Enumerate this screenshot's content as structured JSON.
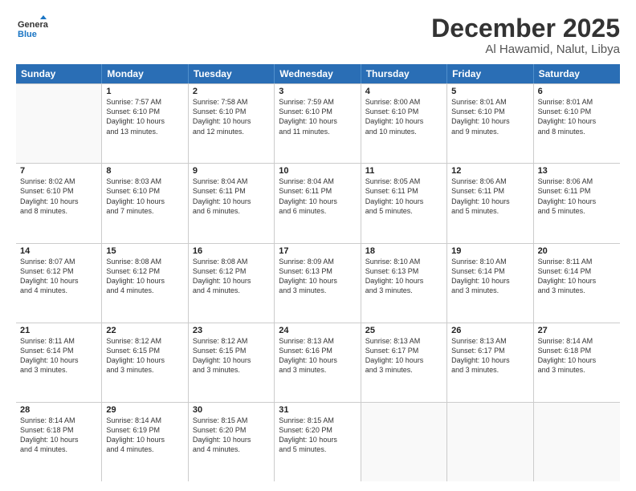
{
  "header": {
    "logo_line1": "General",
    "logo_line2": "Blue",
    "month": "December 2025",
    "location": "Al Hawamid, Nalut, Libya"
  },
  "weekdays": [
    "Sunday",
    "Monday",
    "Tuesday",
    "Wednesday",
    "Thursday",
    "Friday",
    "Saturday"
  ],
  "rows": [
    [
      {
        "day": "",
        "info": ""
      },
      {
        "day": "1",
        "info": "Sunrise: 7:57 AM\nSunset: 6:10 PM\nDaylight: 10 hours\nand 13 minutes."
      },
      {
        "day": "2",
        "info": "Sunrise: 7:58 AM\nSunset: 6:10 PM\nDaylight: 10 hours\nand 12 minutes."
      },
      {
        "day": "3",
        "info": "Sunrise: 7:59 AM\nSunset: 6:10 PM\nDaylight: 10 hours\nand 11 minutes."
      },
      {
        "day": "4",
        "info": "Sunrise: 8:00 AM\nSunset: 6:10 PM\nDaylight: 10 hours\nand 10 minutes."
      },
      {
        "day": "5",
        "info": "Sunrise: 8:01 AM\nSunset: 6:10 PM\nDaylight: 10 hours\nand 9 minutes."
      },
      {
        "day": "6",
        "info": "Sunrise: 8:01 AM\nSunset: 6:10 PM\nDaylight: 10 hours\nand 8 minutes."
      }
    ],
    [
      {
        "day": "7",
        "info": "Sunrise: 8:02 AM\nSunset: 6:10 PM\nDaylight: 10 hours\nand 8 minutes."
      },
      {
        "day": "8",
        "info": "Sunrise: 8:03 AM\nSunset: 6:10 PM\nDaylight: 10 hours\nand 7 minutes."
      },
      {
        "day": "9",
        "info": "Sunrise: 8:04 AM\nSunset: 6:11 PM\nDaylight: 10 hours\nand 6 minutes."
      },
      {
        "day": "10",
        "info": "Sunrise: 8:04 AM\nSunset: 6:11 PM\nDaylight: 10 hours\nand 6 minutes."
      },
      {
        "day": "11",
        "info": "Sunrise: 8:05 AM\nSunset: 6:11 PM\nDaylight: 10 hours\nand 5 minutes."
      },
      {
        "day": "12",
        "info": "Sunrise: 8:06 AM\nSunset: 6:11 PM\nDaylight: 10 hours\nand 5 minutes."
      },
      {
        "day": "13",
        "info": "Sunrise: 8:06 AM\nSunset: 6:11 PM\nDaylight: 10 hours\nand 5 minutes."
      }
    ],
    [
      {
        "day": "14",
        "info": "Sunrise: 8:07 AM\nSunset: 6:12 PM\nDaylight: 10 hours\nand 4 minutes."
      },
      {
        "day": "15",
        "info": "Sunrise: 8:08 AM\nSunset: 6:12 PM\nDaylight: 10 hours\nand 4 minutes."
      },
      {
        "day": "16",
        "info": "Sunrise: 8:08 AM\nSunset: 6:12 PM\nDaylight: 10 hours\nand 4 minutes."
      },
      {
        "day": "17",
        "info": "Sunrise: 8:09 AM\nSunset: 6:13 PM\nDaylight: 10 hours\nand 3 minutes."
      },
      {
        "day": "18",
        "info": "Sunrise: 8:10 AM\nSunset: 6:13 PM\nDaylight: 10 hours\nand 3 minutes."
      },
      {
        "day": "19",
        "info": "Sunrise: 8:10 AM\nSunset: 6:14 PM\nDaylight: 10 hours\nand 3 minutes."
      },
      {
        "day": "20",
        "info": "Sunrise: 8:11 AM\nSunset: 6:14 PM\nDaylight: 10 hours\nand 3 minutes."
      }
    ],
    [
      {
        "day": "21",
        "info": "Sunrise: 8:11 AM\nSunset: 6:14 PM\nDaylight: 10 hours\nand 3 minutes."
      },
      {
        "day": "22",
        "info": "Sunrise: 8:12 AM\nSunset: 6:15 PM\nDaylight: 10 hours\nand 3 minutes."
      },
      {
        "day": "23",
        "info": "Sunrise: 8:12 AM\nSunset: 6:15 PM\nDaylight: 10 hours\nand 3 minutes."
      },
      {
        "day": "24",
        "info": "Sunrise: 8:13 AM\nSunset: 6:16 PM\nDaylight: 10 hours\nand 3 minutes."
      },
      {
        "day": "25",
        "info": "Sunrise: 8:13 AM\nSunset: 6:17 PM\nDaylight: 10 hours\nand 3 minutes."
      },
      {
        "day": "26",
        "info": "Sunrise: 8:13 AM\nSunset: 6:17 PM\nDaylight: 10 hours\nand 3 minutes."
      },
      {
        "day": "27",
        "info": "Sunrise: 8:14 AM\nSunset: 6:18 PM\nDaylight: 10 hours\nand 3 minutes."
      }
    ],
    [
      {
        "day": "28",
        "info": "Sunrise: 8:14 AM\nSunset: 6:18 PM\nDaylight: 10 hours\nand 4 minutes."
      },
      {
        "day": "29",
        "info": "Sunrise: 8:14 AM\nSunset: 6:19 PM\nDaylight: 10 hours\nand 4 minutes."
      },
      {
        "day": "30",
        "info": "Sunrise: 8:15 AM\nSunset: 6:20 PM\nDaylight: 10 hours\nand 4 minutes."
      },
      {
        "day": "31",
        "info": "Sunrise: 8:15 AM\nSunset: 6:20 PM\nDaylight: 10 hours\nand 5 minutes."
      },
      {
        "day": "",
        "info": ""
      },
      {
        "day": "",
        "info": ""
      },
      {
        "day": "",
        "info": ""
      }
    ]
  ]
}
